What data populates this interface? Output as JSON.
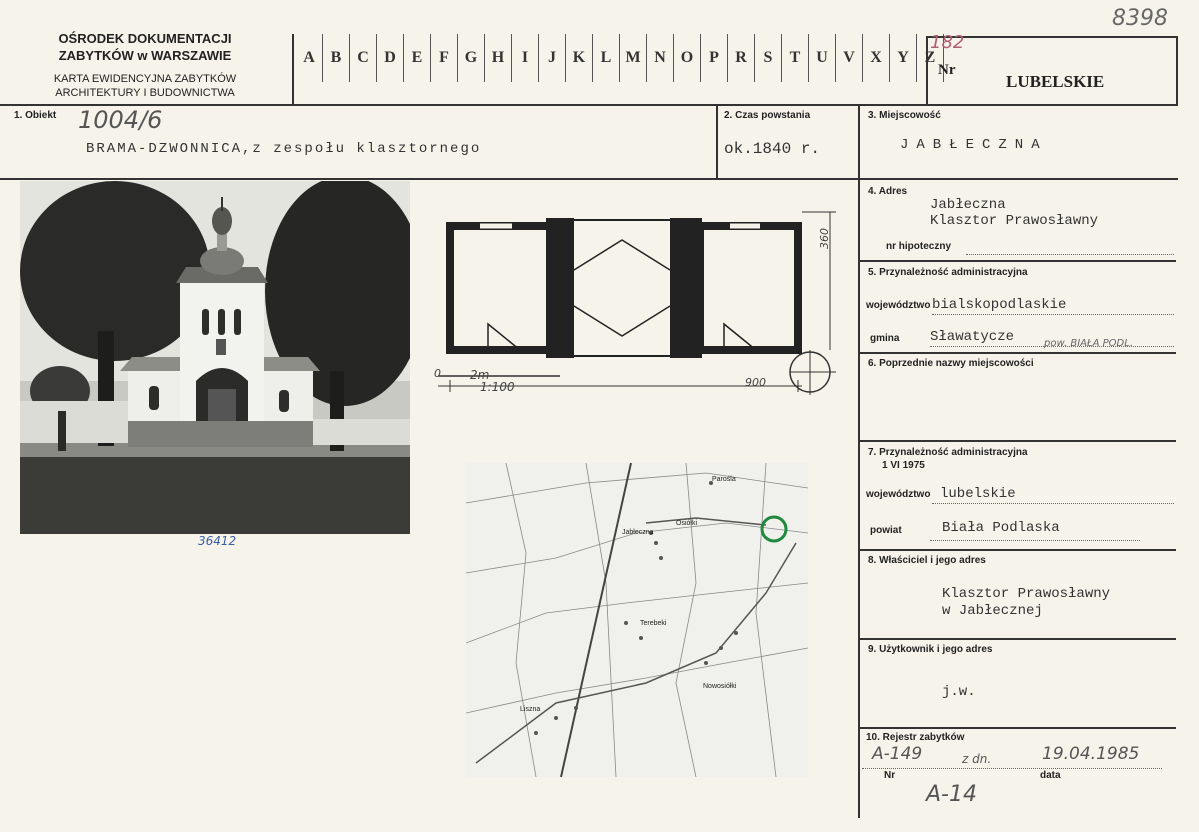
{
  "header": {
    "org_line1": "OŚRODEK DOKUMENTACJI",
    "org_line2": "ZABYTKÓW w WARSZAWIE",
    "card_line1": "KARTA EWIDENCYJNA ZABYTKÓW",
    "card_line2": "ARCHITEKTURY I BUDOWNICTWA",
    "letters": [
      "A",
      "B",
      "C",
      "D",
      "E",
      "F",
      "G",
      "H",
      "I",
      "J",
      "K",
      "L",
      "M",
      "N",
      "O",
      "P",
      "R",
      "S",
      "T",
      "U",
      "V",
      "X",
      "Y",
      "Z"
    ],
    "nr_label": "Nr",
    "nr_hand": "182",
    "region": "LUBELSKIE",
    "corner_number": "8398"
  },
  "fields": {
    "obiekt_label": "1. Obiekt",
    "obiekt_number": "1004/6",
    "obiekt_value": "BRAMA-DZWONNICA,z zespołu klasztornego",
    "czas_label": "2. Czas powstania",
    "czas_value": "ok.1840 r.",
    "miejscowosc_label": "3. Miejscowość",
    "miejscowosc_value": "JABŁECZNA",
    "photo_number": "36412",
    "adres_label": "4. Adres",
    "adres_line1": "Jabłeczna",
    "adres_line2": "Klasztor Prawosławny",
    "nr_hipoteczny_label": "nr hipoteczny",
    "przyn_label": "5. Przynależność administracyjna",
    "wojewodztwo_label": "województwo",
    "wojewodztwo_value": "bialskopodlaskie",
    "gmina_label": "gmina",
    "gmina_value": "Sławatycze",
    "gmina_note": "pow. BIAŁA PODL.",
    "poprzednie_label": "6. Poprzednie nazwy miejscowości",
    "przyn1975_label": "7. Przynależność administracyjna",
    "przyn1975_date": "1 VI 1975",
    "wojewodztwo2_label": "województwo",
    "wojewodztwo2_value": "lubelskie",
    "powiat_label": "powiat",
    "powiat_value": "Biała Podlaska",
    "wlasciciel_label": "8. Właściciel i jego adres",
    "wlasciciel_line1": "Klasztor Prawosławny",
    "wlasciciel_line2": "w Jabłecznej",
    "uzytkownik_label": "9. Użytkownik i jego adres",
    "uzytkownik_value": "j.w.",
    "rejestr_label": "10. Rejestr zabytków",
    "rejestr_nr_hand": "A-149",
    "rejestr_z_dn": "z dn.",
    "rejestr_date_hand": "19.04.1985",
    "rejestr_nr_label": "Nr",
    "rejestr_data_label": "data",
    "rejestr_bottom_hand": "A-14"
  },
  "plan": {
    "scale_label": "1:100",
    "scale_2m": "2m",
    "dim_bottom": "900",
    "dim_right": "360",
    "scale_zero": "0"
  },
  "map": {
    "place_jableczna": "Jabłeczna",
    "place_terebeki": "Terebeki",
    "place_nowosiolki": "Nowosiółki",
    "place_liszna": "Liszna",
    "place_parosla": "Parośla",
    "place_osiolki": "Osiółki",
    "marker_color": "#1f8a3c"
  }
}
